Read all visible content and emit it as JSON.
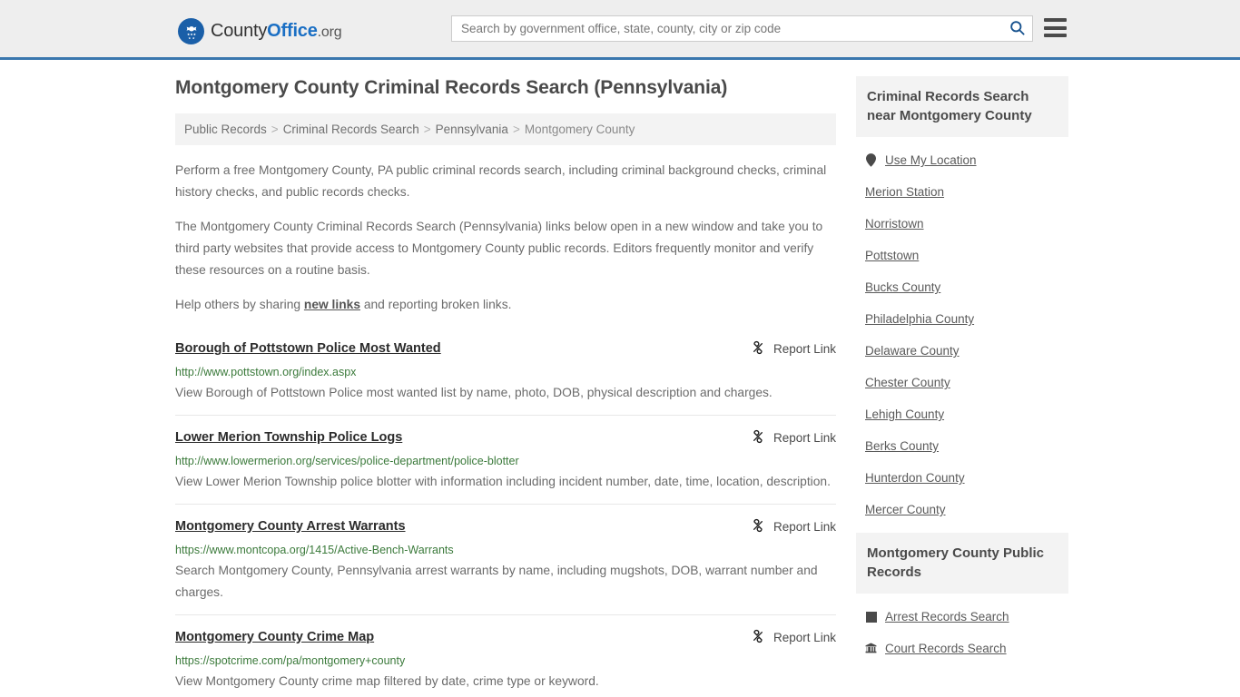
{
  "header": {
    "brand": {
      "part1": "County",
      "part2": "Office",
      "part3": ".org",
      "logo_icon": "eagle-seal-logo"
    },
    "search": {
      "placeholder": "Search by government office, state, county, city or zip code",
      "value": "",
      "search_icon": "search-icon"
    },
    "menu_icon": "hamburger-menu-icon",
    "accent_color": "#3a77ae",
    "background_color": "#eeeeee"
  },
  "main": {
    "page_title": "Montgomery County Criminal Records Search (Pennsylvania)",
    "breadcrumb": [
      "Public Records",
      "Criminal Records Search",
      "Pennsylvania",
      "Montgomery County"
    ],
    "breadcrumb_separator": ">",
    "intro_paragraphs": [
      "Perform a free Montgomery County, PA public criminal records search, including criminal background checks, criminal history checks, and public records checks.",
      "The Montgomery County Criminal Records Search (Pennsylvania) links below open in a new window and take you to third party websites that provide access to Montgomery County public records. Editors frequently monitor and verify these resources on a routine basis."
    ],
    "help_line": {
      "before": "Help others by sharing ",
      "link": "new links",
      "after": " and reporting broken links."
    },
    "report_link_label": "Report Link",
    "report_link_icon": "broken-link-icon",
    "results": [
      {
        "title": "Borough of Pottstown Police Most Wanted",
        "url": "http://www.pottstown.org/index.aspx",
        "description": "View Borough of Pottstown Police most wanted list by name, photo, DOB, physical description and charges."
      },
      {
        "title": "Lower Merion Township Police Logs",
        "url": "http://www.lowermerion.org/services/police-department/police-blotter",
        "description": "View Lower Merion Township police blotter with information including incident number, date, time, location, description."
      },
      {
        "title": "Montgomery County Arrest Warrants",
        "url": "https://www.montcopa.org/1415/Active-Bench-Warrants",
        "description": "Search Montgomery County, Pennsylvania arrest warrants by name, including mugshots, DOB, warrant number and charges."
      },
      {
        "title": "Montgomery County Crime Map",
        "url": "https://spotcrime.com/pa/montgomery+county",
        "description": "View Montgomery County crime map filtered by date, crime type or keyword."
      }
    ]
  },
  "sidebar": {
    "nearby": {
      "heading": "Criminal Records Search near Montgomery County",
      "items": [
        {
          "label": "Use My Location",
          "icon": "map-pin-icon"
        },
        {
          "label": "Merion Station",
          "icon": ""
        },
        {
          "label": "Norristown",
          "icon": ""
        },
        {
          "label": "Pottstown",
          "icon": ""
        },
        {
          "label": "Bucks County",
          "icon": ""
        },
        {
          "label": "Philadelphia County",
          "icon": ""
        },
        {
          "label": "Delaware County",
          "icon": ""
        },
        {
          "label": "Chester County",
          "icon": ""
        },
        {
          "label": "Lehigh County",
          "icon": ""
        },
        {
          "label": "Berks County",
          "icon": ""
        },
        {
          "label": "Hunterdon County",
          "icon": ""
        },
        {
          "label": "Mercer County",
          "icon": ""
        }
      ]
    },
    "public_records": {
      "heading": "Montgomery County Public Records",
      "items": [
        {
          "label": "Arrest Records Search",
          "icon": "square-badge-icon"
        },
        {
          "label": "Court Records Search",
          "icon": "courthouse-icon"
        }
      ]
    }
  }
}
